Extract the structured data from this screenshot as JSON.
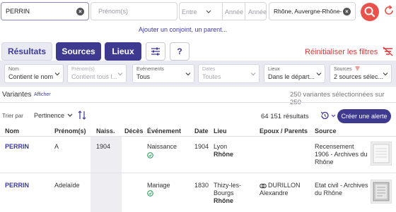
{
  "search": {
    "nom_value": "PERRIN",
    "prenom_placeholder": "Prénom(s)",
    "entre_placeholder": "Entre",
    "annee1_placeholder": "Année",
    "annee2_placeholder": "Année",
    "lieu_value": "Rhône, Auvergne-Rhône-Al",
    "add_link": "Ajouter un conjoint, un parent..."
  },
  "tabs": {
    "resultats": "Résultats",
    "sources": "Sources",
    "lieux": "Lieux",
    "help": "?",
    "reset": "Réinitialiser les filtres"
  },
  "filters": [
    {
      "label": "Nom",
      "value": "Contient le nom",
      "disabled": false
    },
    {
      "label": "Prénom(s)",
      "value": "Contient tous l...",
      "disabled": true
    },
    {
      "label": "Evénements",
      "value": "Tous",
      "disabled": false
    },
    {
      "label": "Dates",
      "value": "Toutes",
      "disabled": true
    },
    {
      "label": "Lieux",
      "value": "Dans le départ...",
      "disabled": false
    },
    {
      "label": "Sources",
      "value": "2 sources sélec...",
      "disabled": false
    }
  ],
  "variants": {
    "title": "Variantes",
    "show_link": "Afficher",
    "count": "250 variantes sélectionnées sur 250"
  },
  "toolbar": {
    "sort_label": "Trier par",
    "sort_value": "Pertinence",
    "results_count": "64 151 résultats",
    "create_alert": "Créer une alerte"
  },
  "columns": [
    "Nom",
    "Prénom(s)",
    "Naiss.",
    "Décès",
    "Événement",
    "Date",
    "Lieu",
    "Epoux / Parents",
    "Source"
  ],
  "rows": [
    {
      "nom": "PERRIN",
      "prenom": "A",
      "naiss": "1904",
      "deces": "",
      "event": "Naissance",
      "date": "1904",
      "lieu_1": "Lyon",
      "lieu_2": "Rhône",
      "lieu_3": "",
      "parents_1": "",
      "parents_2": "",
      "source_1": "Recensement",
      "source_2": "1906 - Archives du",
      "source_3": "Rhône"
    },
    {
      "nom": "PERRIN",
      "prenom": "Adelaïde",
      "naiss": "",
      "deces": "",
      "event": "Mariage",
      "date": "1830",
      "lieu_1": "Thizy-les-",
      "lieu_2": "Bourgs",
      "lieu_3": "Rhône",
      "parents_1": "DURILLON",
      "parents_2": "Alexandre",
      "source_1": "Etat civil - Archives",
      "source_2": "du Rhône",
      "source_3": ""
    }
  ],
  "colors": {
    "accent": "#3d3a9a",
    "dark_tab": "#3d3a8f",
    "search_button": "#e8524a",
    "reset_red": "#d63a3a",
    "success_green": "#2a9d5a"
  }
}
